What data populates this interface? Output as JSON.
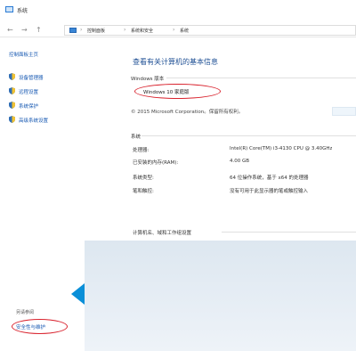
{
  "window": {
    "title": "系统"
  },
  "address": {
    "back_glyph": "←",
    "forward_glyph": "→",
    "up_glyph": "↑",
    "crumbs": [
      "控制面板",
      "系统和安全",
      "系统"
    ],
    "separator": "›"
  },
  "sidebar": {
    "home": "控制面板主页",
    "items": [
      {
        "label": "设备管理器",
        "icon": "shield-icon"
      },
      {
        "label": "远程设置",
        "icon": "shield-icon"
      },
      {
        "label": "系统保护",
        "icon": "shield-icon"
      },
      {
        "label": "高级系统设置",
        "icon": "shield-icon"
      }
    ],
    "see_also": "另请参阅",
    "security_link": "安全性与维护"
  },
  "main": {
    "heading": "查看有关计算机的基本信息",
    "windows_section": "Windows 版本",
    "edition": "Windows 10 家庭版",
    "copyright": "© 2015 Microsoft Corporation。保留所有权利。",
    "system_section": "系统",
    "rows": [
      {
        "label": "处理器:",
        "value": "Intel(R) Core(TM) i3-4130 CPU @ 3.40GHz"
      },
      {
        "label": "已安装的内存(RAM):",
        "value": "4.00 GB"
      },
      {
        "label": "系统类型:",
        "value": "64 位操作系统，基于 x64 的处理器"
      },
      {
        "label": "笔和触控:",
        "value": "没有可用于此显示器的笔或触控输入"
      }
    ],
    "computer_section": "计算机名、域和工作组设置"
  },
  "colors": {
    "accent": "#1a5bb3",
    "heading": "#1e4f94",
    "highlight_oval": "#d9232e",
    "overlay_arrow": "#0a8fd8"
  }
}
